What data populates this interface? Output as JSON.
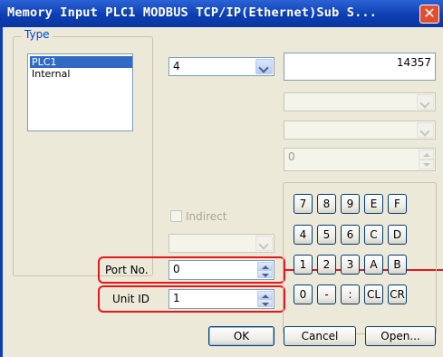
{
  "window": {
    "title": "Memory Input  PLC1  MODBUS TCP/IP(Ethernet)Sub S...",
    "close_icon": "close-icon"
  },
  "type_group": {
    "label": "Type",
    "items": [
      "PLC1",
      "Internal"
    ],
    "selected": "PLC1"
  },
  "device_combo": {
    "value": "4"
  },
  "address_field": {
    "value": "14357"
  },
  "disabled_spin": {
    "value": "0"
  },
  "indirect": {
    "label": "Indirect",
    "checked": false
  },
  "port": {
    "label": "Port No.",
    "value": "0"
  },
  "unit": {
    "label": "Unit ID",
    "value": "1"
  },
  "keypad": {
    "row1": [
      "7",
      "8",
      "9",
      "E",
      "F"
    ],
    "row2": [
      "4",
      "5",
      "6",
      "C",
      "D"
    ],
    "row3": [
      "1",
      "2",
      "3",
      "A",
      "B"
    ],
    "row4": [
      "0",
      "-",
      ":",
      "CL",
      "CR"
    ]
  },
  "buttons": {
    "ok": "OK",
    "cancel": "Cancel",
    "open": "Open..."
  },
  "colors": {
    "title_bar": "#0d3fb2",
    "highlight": "#e8151b",
    "selection": "#316ac5"
  }
}
